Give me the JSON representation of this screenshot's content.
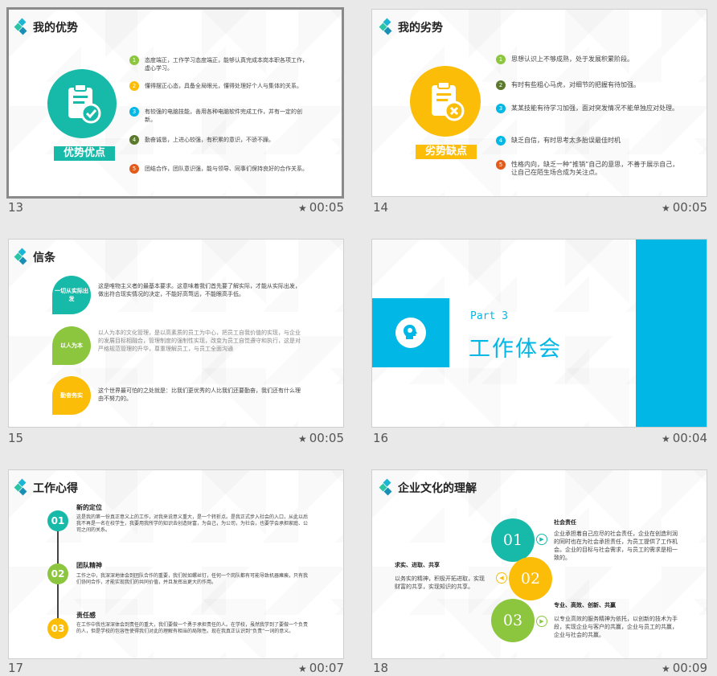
{
  "slides": [
    {
      "number": "13",
      "duration": "00:05",
      "title": "我的优势",
      "banner": "优势优点",
      "items": [
        {
          "num": "1",
          "text": "态度端正，工作学习态度端正，能够认真完成本岗本职各项工作，虚心学习。"
        },
        {
          "num": "2",
          "text": "懂得摆正心态，具备全局眼光，懂得处理好个人与集体的关系。"
        },
        {
          "num": "3",
          "text": "有较强的电脑技能，善用各种电脑软件完成工作，并有一定的创新。"
        },
        {
          "num": "4",
          "text": "勤奋诚恳，上进心较强，有积累的意识，不骄不躁。"
        },
        {
          "num": "5",
          "text": "团结合作，团队意识强，能与领导、同事们保持良好的合作关系。"
        }
      ]
    },
    {
      "number": "14",
      "duration": "00:05",
      "title": "我的劣势",
      "banner": "劣势缺点",
      "items": [
        {
          "num": "1",
          "text": "思想认识上不够成熟，处于发展积累阶段。"
        },
        {
          "num": "2",
          "text": "有时有些粗心马虎，对细节的把握有待加强。"
        },
        {
          "num": "3",
          "text": "某某技能有待学习加强，面对突发情况不能单独应对处理。"
        },
        {
          "num": "4",
          "text": "缺乏自信，有时思考太多胎误最佳时机"
        },
        {
          "num": "5",
          "text": "性格内向，缺乏一种“推销”自己的意思，不善于展示自己，让自己在陌生场合成为关注点。"
        }
      ]
    },
    {
      "number": "15",
      "duration": "00:05",
      "title": "信条",
      "items": [
        {
          "label": "一切从实际出发",
          "text": "这是唯物主义者的最基本要求。这意味着我们首先要了解实际，才能从实际出发，做出符合现实情况的决定，不能好高骛远，不能眼高手低。"
        },
        {
          "label": "以人为本",
          "text": "以人为本的文化管理，是以高素质的员工为中心，把员工自我价值的实现，与企业的发展目标相融合，管理制度的强制性实现，改变为员工自觉遵守和执行，这是对严格规范管理的升华，尊重理解员工，与员工全面沟通"
        },
        {
          "label": "勤奋务实",
          "text": "这个世界最可怕的之处就是：比我们更优秀的人比我们还要勤奋，我们还有什么理由不努力的。"
        }
      ]
    },
    {
      "number": "16",
      "duration": "00:04",
      "part": "Part 3",
      "heading": "工作体会"
    },
    {
      "number": "17",
      "duration": "00:07",
      "title": "工作心得",
      "items": [
        {
          "num": "01",
          "head": "新的定位",
          "text": "这是我的第一份真正意义上的工作，对我来说意义重大，是一个转折点。是我正式步入社会的入口，从此以后我不再是一名在校学生，我要用我所学的知识去创造财富，为自己，为公司，为社会，也要学会承担家庭、公司之间的关系。"
        },
        {
          "num": "02",
          "head": "团队精神",
          "text": "工作之中，我深深地体会到团队合作的重要，我们就如螺丝钉，任何一个岗队都有可能导致机器瘫痪，只有我们协同合作，才能实现我们的共同价值，并且发挥出更大的作用。"
        },
        {
          "num": "03",
          "head": "责任感",
          "text": "在工作中我也深深体会到责任的重大，我们要做一个勇于承担责任的人。在学校，虽然我学到了要做一个负责的人，但是学校的包容性使得我们对此的理解有相当的局限性。现在我真正认识到“负责”一词的意义。"
        }
      ]
    },
    {
      "number": "18",
      "duration": "00:09",
      "title": "企业文化的理解",
      "circles": [
        "01",
        "02",
        "03"
      ],
      "blocks": [
        {
          "head": "社会责任",
          "text": "企业承担着自己应尽的社会责任，企业在创造利润的同时也在为社会承担责任，为员工提供了工作机会。企业的目标与社会需求，与员工的需求是相一致的。"
        },
        {
          "head": "求实、进取、共享",
          "text": "以务实的精神，积极开拓进取，实现财富的共享，实现知识的共享。"
        },
        {
          "head": "专业、高效、创新、共赢",
          "text": "以专业高效的服务精神为依托，以创新的技术为手段，实现企业与客户的共赢，企业与员工的共赢，企业与社会的共赢。"
        }
      ]
    }
  ],
  "colors": {
    "teal": "#17b9a8",
    "yellow": "#fbbd08",
    "green": "#8cc63f",
    "blue": "#00b7e6",
    "orange": "#e35b1a",
    "dark_green": "#5c7a2d"
  },
  "icons": [
    "clipboard-check-icon",
    "clipboard-x-icon",
    "head-lightbulb-icon",
    "star-icon",
    "play-icon"
  ]
}
